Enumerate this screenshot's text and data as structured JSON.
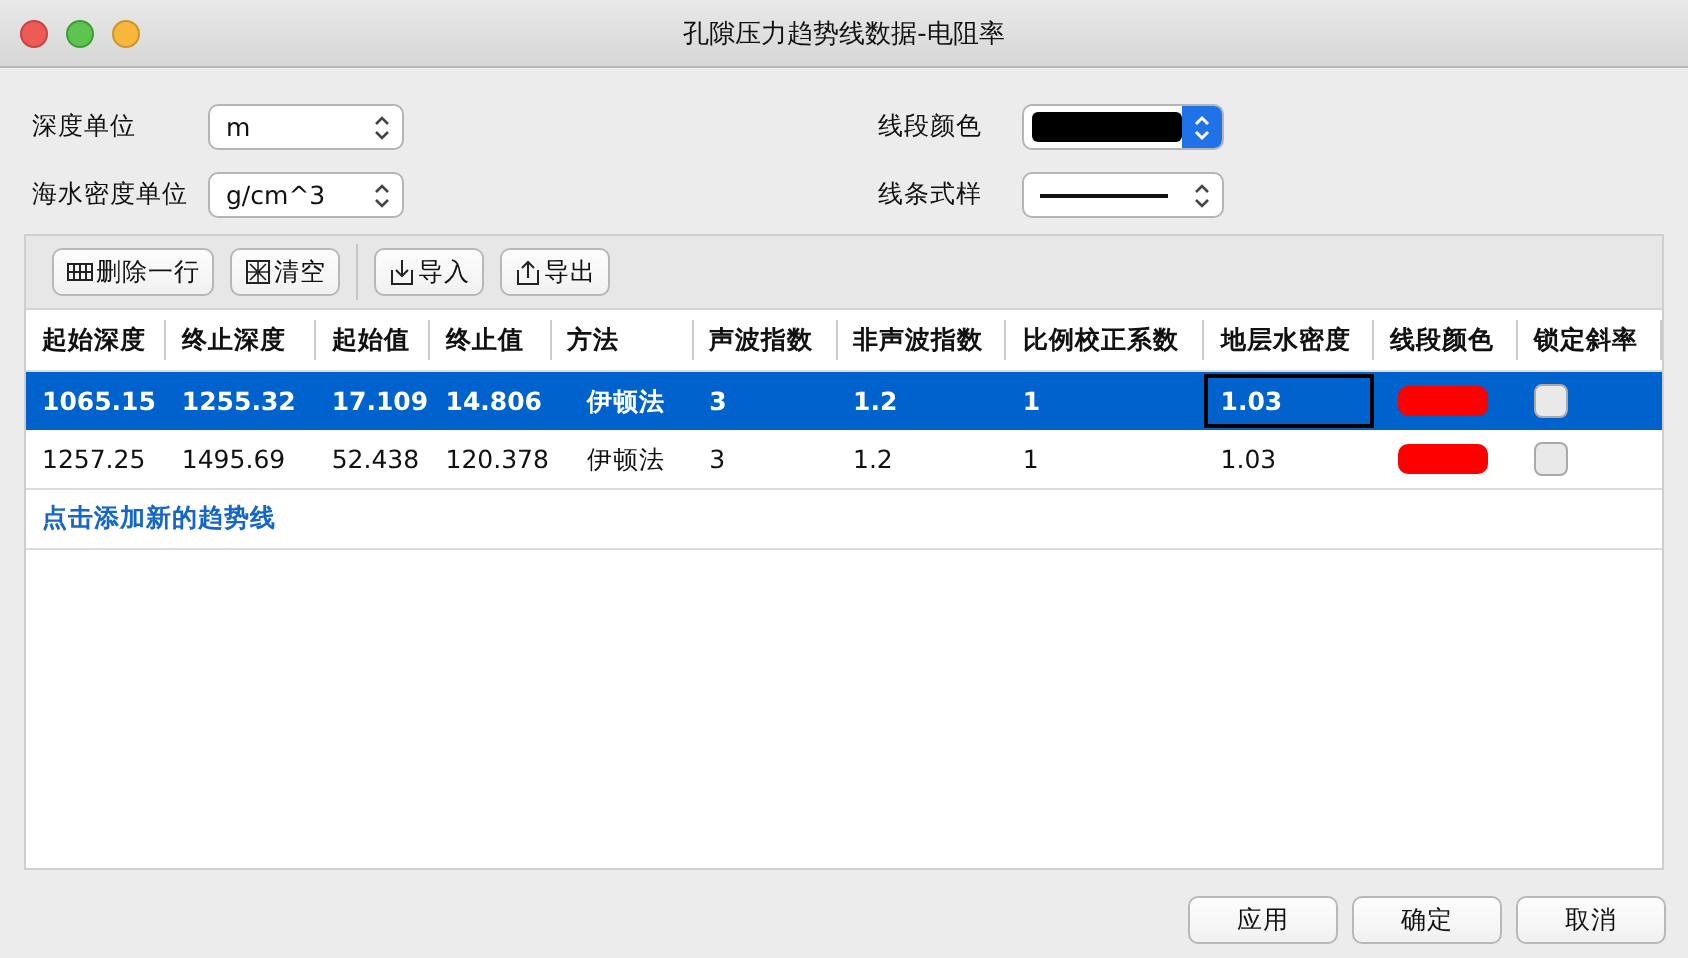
{
  "window": {
    "title": "孔隙压力趋势线数据-电阻率"
  },
  "settings": {
    "depth_unit": {
      "label": "深度单位",
      "value": "m"
    },
    "density_unit": {
      "label": "海水密度单位",
      "value": "g/cm^3"
    },
    "line_color": {
      "label": "线段颜色",
      "color": "#000000"
    },
    "line_style": {
      "label": "线条式样"
    }
  },
  "toolbar": [
    {
      "label": "删除一行",
      "kind": "delete"
    },
    {
      "label": "清空",
      "kind": "clear"
    },
    {
      "label": "导入",
      "kind": "import"
    },
    {
      "label": "导出",
      "kind": "export"
    }
  ],
  "table": {
    "columns": [
      "起始深度",
      "终止深度",
      "起始值",
      "终止值",
      "方法",
      "声波指数",
      "非声波指数",
      "比例校正系数",
      "地层水密度",
      "线段颜色",
      "锁定斜率"
    ],
    "rows": [
      {
        "selected": true,
        "cells": [
          "1065.15",
          "1255.32",
          "17.109",
          "14.806",
          "伊顿法",
          "3",
          "1.2",
          "1"
        ],
        "density": {
          "value": "1.03",
          "focused": true
        },
        "color": "#ff0000",
        "locked": false
      },
      {
        "selected": false,
        "cells": [
          "1257.25",
          "1495.69",
          "52.438",
          "120.378",
          "伊顿法",
          "3",
          "1.2",
          "1"
        ],
        "density": {
          "value": "1.03",
          "focused": false
        },
        "color": "#ff0000",
        "locked": false
      }
    ],
    "add_link": "点击添加新的趋势线"
  },
  "buttons": [
    "应用",
    "确定",
    "取消"
  ]
}
